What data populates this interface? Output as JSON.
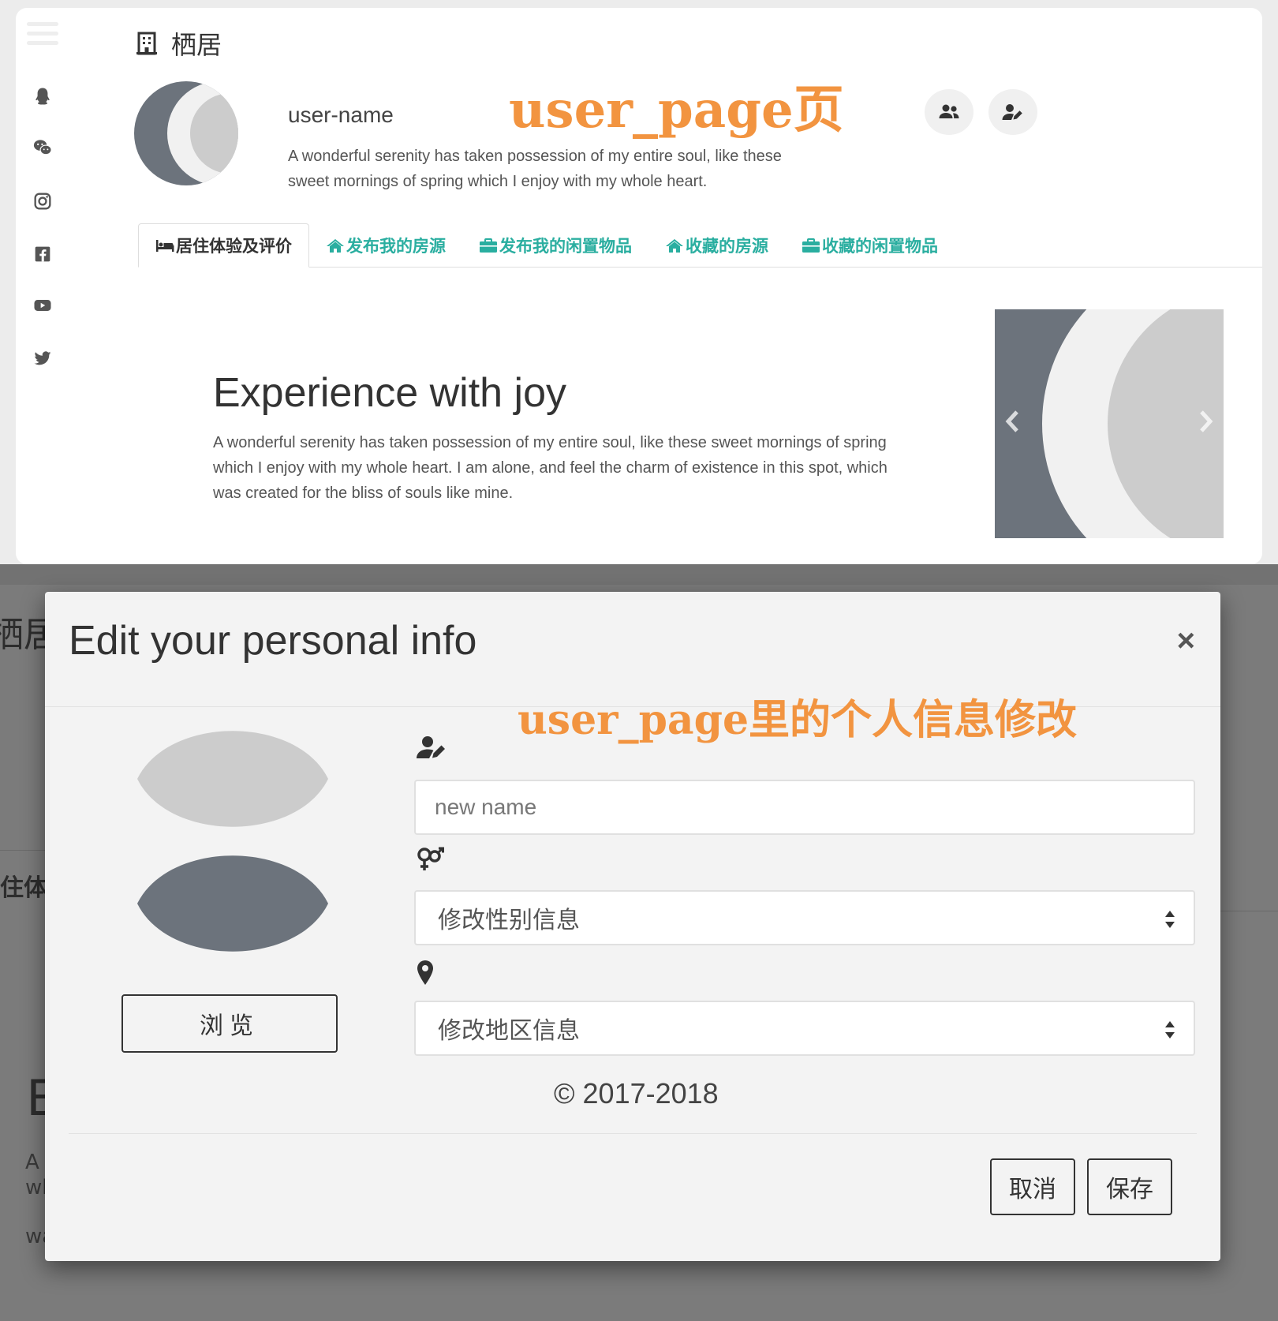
{
  "user_page": {
    "brand": "栖居",
    "annotation": "user_page页",
    "user": {
      "name": "user-name",
      "bio": "A wonderful serenity has taken possession of my entire soul, like these sweet mornings of spring which I enjoy with my whole heart."
    },
    "tabs": [
      {
        "label": "居住体验及评价",
        "icon": "bed-icon",
        "active": true
      },
      {
        "label": "发布我的房源",
        "icon": "home-icon",
        "active": false
      },
      {
        "label": "发布我的闲置物品",
        "icon": "briefcase-icon",
        "active": false
      },
      {
        "label": "收藏的房源",
        "icon": "home-icon",
        "active": false
      },
      {
        "label": "收藏的闲置物品",
        "icon": "briefcase-icon",
        "active": false
      }
    ],
    "section": {
      "title": "Experience with joy",
      "text": "A wonderful serenity has taken possession of my entire soul, like these sweet mornings of spring which I enjoy with my whole heart. I am alone, and feel the charm of existence in this spot, which was created for the bliss of souls like mine."
    },
    "sidebar_icons": [
      "qq-icon",
      "wechat-icon",
      "instagram-icon",
      "facebook-icon",
      "youtube-icon",
      "twitter-icon"
    ],
    "header_buttons": [
      "users-icon",
      "user-edit-icon"
    ]
  },
  "modal": {
    "annotation": "user_page里的个人信息修改",
    "title": "Edit your personal info",
    "close_label": "×",
    "browse_label": "浏览",
    "name_placeholder": "new name",
    "gender_select": "修改性别信息",
    "region_select": "修改地区信息",
    "copyright": "© 2017-2018",
    "cancel_label": "取消",
    "save_label": "保存"
  },
  "background_glimpse": {
    "brand_fragment": "栖居",
    "tab_fragment": "住体",
    "title_fragment": "E",
    "text_fragments": [
      "A",
      "wh",
      "wa"
    ]
  },
  "colors": {
    "accent": "#2aaea0",
    "annotation": "#f29440",
    "placeholder_dark": "#6c737c",
    "placeholder_light": "#cccccc",
    "placeholder_bg": "#f1f1f1",
    "overlay": "#7b7b7b"
  }
}
